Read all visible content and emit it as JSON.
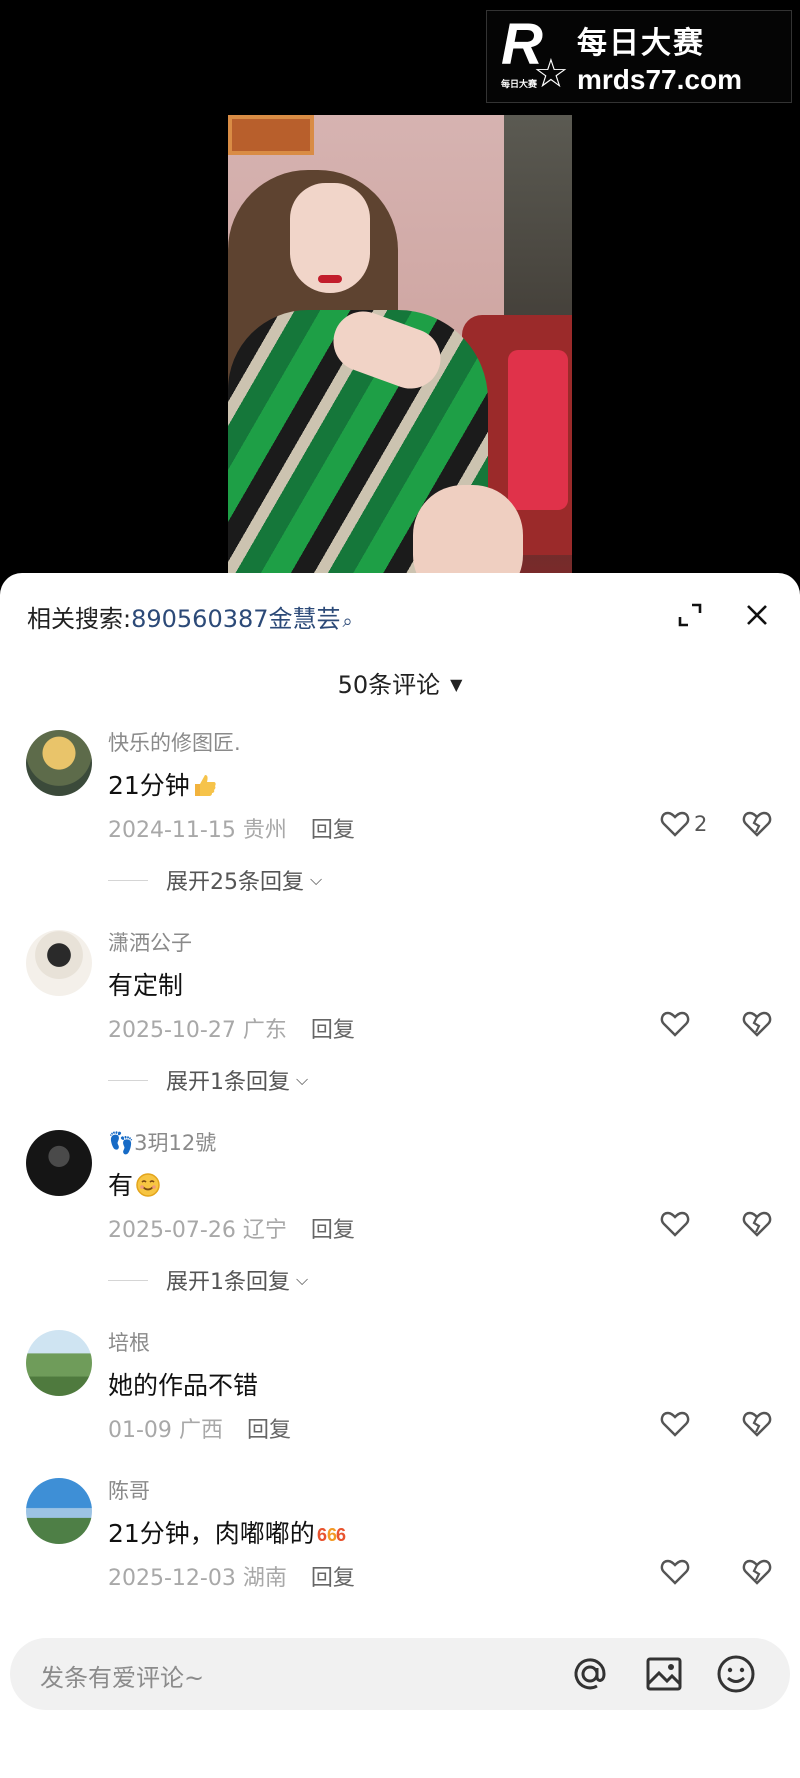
{
  "watermark": {
    "logo_letter": "R",
    "logo_star": "☆",
    "logo_small": "每日大赛",
    "line1": "每日大赛",
    "line2": "mrds77.com"
  },
  "panel": {
    "related_label": "相关搜索:",
    "related_keyword": "890560387金慧芸",
    "comment_count": "50条评论"
  },
  "comments": [
    {
      "user": "快乐的修图匠.",
      "text": "21分钟",
      "emoji": "thumbs-up",
      "date": "2024-11-15",
      "location": "贵州",
      "reply_label": "回复",
      "likes": "2",
      "expand": "展开25条回复"
    },
    {
      "user": "潇洒公子",
      "text": "有定制",
      "date": "2025-10-27",
      "location": "广东",
      "reply_label": "回复",
      "likes": "",
      "expand": "展开1条回复"
    },
    {
      "user": "3玥12號",
      "user_prefix_icon": "footprints",
      "text": "有",
      "emoji": "smile",
      "date": "2025-07-26",
      "location": "辽宁",
      "reply_label": "回复",
      "likes": "",
      "expand": "展开1条回复"
    },
    {
      "user": "培根",
      "text": "她的作品不错",
      "date": "01-09",
      "location": "广西",
      "reply_label": "回复",
      "likes": ""
    },
    {
      "user": "陈哥",
      "text": "21分钟，肉嘟嘟的",
      "emoji": "666",
      "date": "2025-12-03",
      "location": "湖南",
      "reply_label": "回复",
      "likes": ""
    }
  ],
  "input": {
    "placeholder": "发条有爱评论~"
  },
  "colors": {
    "link": "#2c4a78",
    "muted": "#8a8a8a",
    "text": "#111111"
  }
}
